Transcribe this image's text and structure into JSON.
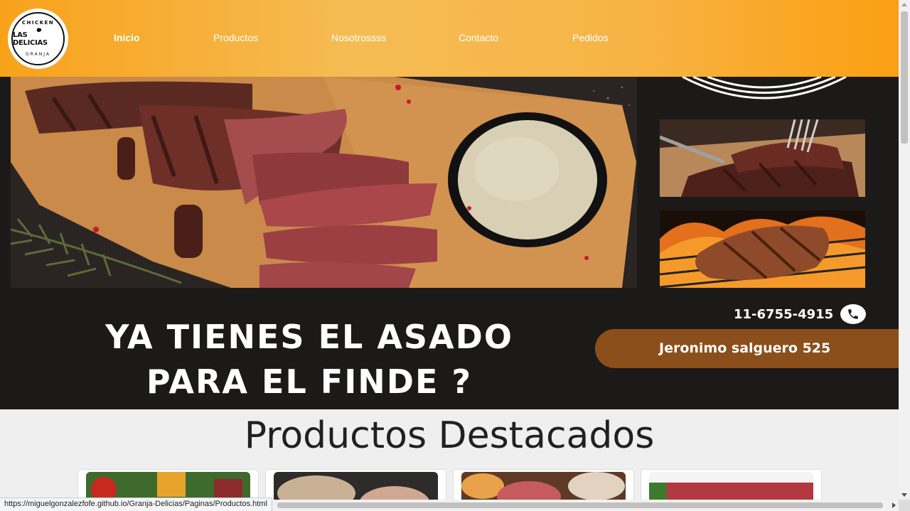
{
  "logo": {
    "top_text": "CHICKEN",
    "main_text": "LAS DELICIAS",
    "bottom_text": "GRANJA"
  },
  "nav": {
    "items": [
      {
        "label": "Inicio",
        "active": true
      },
      {
        "label": "Productos",
        "active": false
      },
      {
        "label": "Nosotrossss",
        "active": false
      },
      {
        "label": "Contacto",
        "active": false
      },
      {
        "label": "Pedidos",
        "active": false
      }
    ]
  },
  "hero": {
    "headline_line1": "YA TIENES EL ASADO",
    "headline_line2": "PARA EL FINDE ?",
    "phone": "11-6755-4915",
    "phone_icon": "phone-icon",
    "address": "Jeronimo salguero 525"
  },
  "featured": {
    "title": "Productos Destacados"
  },
  "status_bar": {
    "url": "https://miguelgonzalezfofe.github.io/Granja-Delicias/Paginas/Productos.html"
  },
  "colors": {
    "header_orange": "#f8a21a",
    "hero_dark": "#1c1a19",
    "address_brown": "#8a4f1b"
  }
}
